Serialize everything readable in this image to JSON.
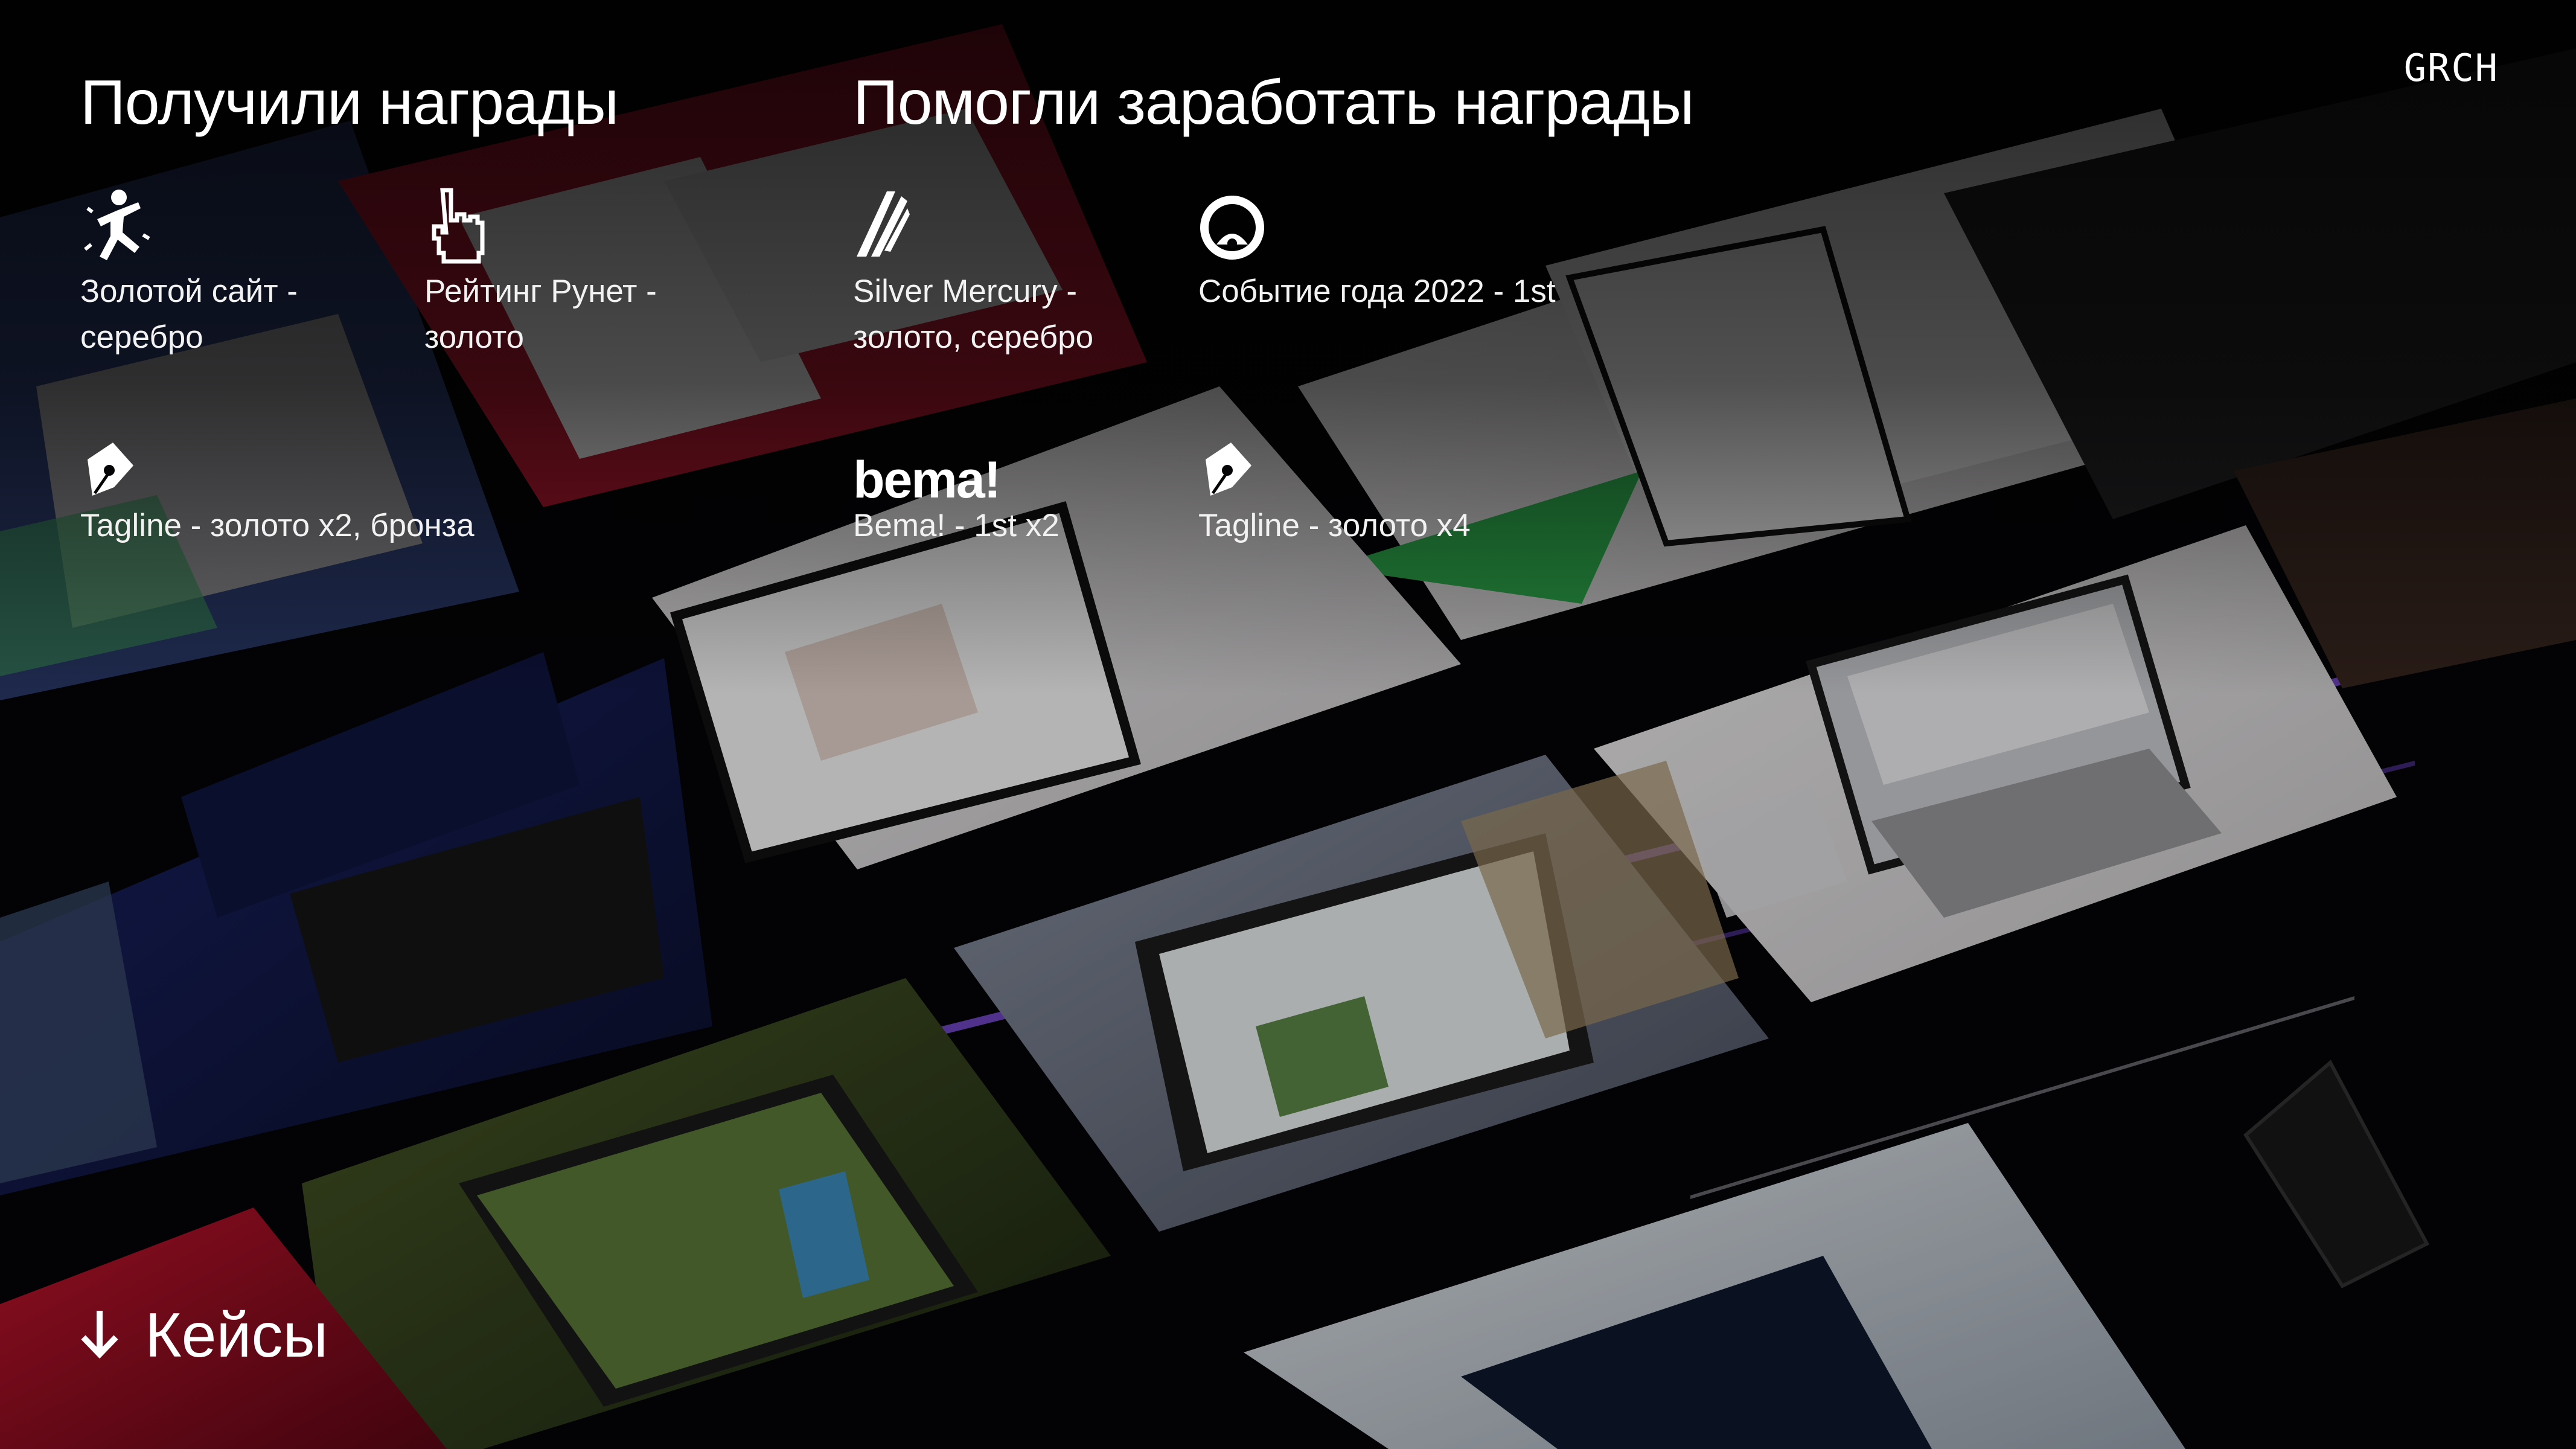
{
  "brand": {
    "logo_text": "GRCH"
  },
  "received": {
    "heading": "Получили награды",
    "awards": [
      {
        "icon": "golden-site-icon",
        "label_line1": "Золотой сайт -",
        "label_line2": "серебро"
      },
      {
        "icon": "pointer-hand-icon",
        "label_line1": "Рейтинг Рунет -",
        "label_line2": "золото"
      },
      {
        "icon": "pen-nib-icon",
        "label_line1": "Tagline - золото x2, бронза",
        "label_line2": ""
      }
    ]
  },
  "helped": {
    "heading": "Помогли заработать награды",
    "awards": [
      {
        "icon": "silver-mercury-icon",
        "label_line1": "Silver Mercury -",
        "label_line2": "золото, серебро"
      },
      {
        "icon": "event-of-year-icon",
        "label_line1": "Событие года 2022 - 1st",
        "label_line2": ""
      },
      {
        "icon": "bema-logo",
        "logo_text": "bema!",
        "label_line1": "Bema! - 1st x2",
        "label_line2": ""
      },
      {
        "icon": "pen-nib-icon",
        "label_line1": "Tagline - золото x4",
        "label_line2": ""
      }
    ]
  },
  "cases_link": {
    "icon": "arrow-down-icon",
    "label": "Кейсы"
  },
  "colors": {
    "background": "#050507",
    "text": "#ffffff",
    "accent_purple": "#7b4bd6",
    "accent_red": "#c0142c"
  }
}
